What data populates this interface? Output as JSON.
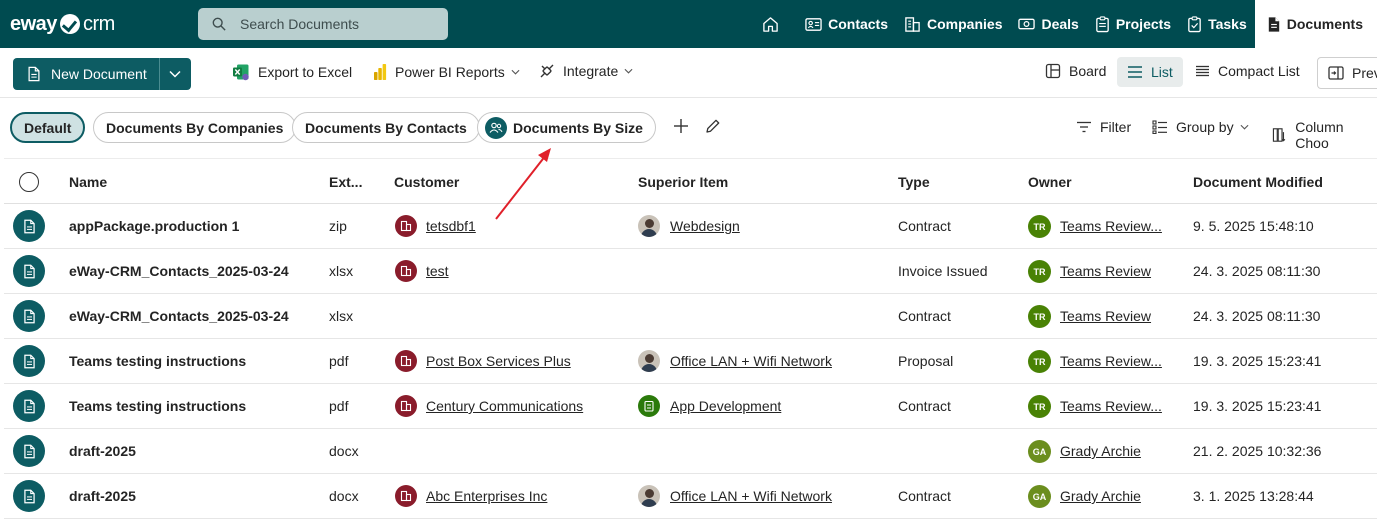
{
  "app": {
    "logo_eway": "eway",
    "logo_crm": "crm"
  },
  "search": {
    "placeholder": "Search Documents",
    "value": ""
  },
  "nav": {
    "items": [
      {
        "label": "Contacts",
        "icon": "contacts-icon"
      },
      {
        "label": "Companies",
        "icon": "companies-icon"
      },
      {
        "label": "Deals",
        "icon": "deals-icon"
      },
      {
        "label": "Projects",
        "icon": "projects-icon"
      },
      {
        "label": "Tasks",
        "icon": "tasks-icon"
      },
      {
        "label": "Documents",
        "icon": "documents-icon",
        "active": true
      }
    ]
  },
  "toolbar": {
    "new_document": "New Document",
    "export_excel": "Export to Excel",
    "power_bi": "Power BI Reports",
    "integrate": "Integrate",
    "board": "Board",
    "list": "List",
    "compact_list": "Compact List",
    "preview": "Prev"
  },
  "views": {
    "tabs": [
      {
        "label": "Default",
        "active": true
      },
      {
        "label": "Documents By Companies"
      },
      {
        "label": "Documents By Contacts"
      },
      {
        "label": "Documents By Size"
      }
    ],
    "filter": "Filter",
    "group_by": "Group by",
    "column_chooser": "Column Choo"
  },
  "table": {
    "columns": [
      "Name",
      "Ext...",
      "Customer",
      "Superior Item",
      "Type",
      "Owner",
      "Document Modified"
    ],
    "rows": [
      {
        "name": "appPackage.production 1",
        "ext": "zip",
        "customer": "tetsdbf1",
        "superior": "Webdesign",
        "superior_icon": "photo",
        "type": "Contract",
        "owner_initials": "TR",
        "owner": "Teams Review...",
        "owner_color": "#498205",
        "modified": "9. 5. 2025 15:48:10"
      },
      {
        "name": "eWay-CRM_Contacts_2025-03-24",
        "ext": "xlsx",
        "customer": "test",
        "superior": "",
        "superior_icon": "",
        "type": "Invoice Issued",
        "owner_initials": "TR",
        "owner": "Teams Review",
        "owner_color": "#498205",
        "modified": "24. 3. 2025 08:11:30"
      },
      {
        "name": "eWay-CRM_Contacts_2025-03-24",
        "ext": "xlsx",
        "customer": "",
        "superior": "",
        "superior_icon": "",
        "type": "Contract",
        "owner_initials": "TR",
        "owner": "Teams Review",
        "owner_color": "#498205",
        "modified": "24. 3. 2025 08:11:30"
      },
      {
        "name": "Teams testing instructions",
        "ext": "pdf",
        "customer": "Post Box Services Plus",
        "superior": "Office LAN + Wifi Network",
        "superior_icon": "photo",
        "type": "Proposal",
        "owner_initials": "TR",
        "owner": "Teams Review...",
        "owner_color": "#498205",
        "modified": "19. 3. 2025 15:23:41"
      },
      {
        "name": "Teams testing instructions",
        "ext": "pdf",
        "customer": "Century Communications",
        "superior": "App Development",
        "superior_icon": "green",
        "type": "Contract",
        "owner_initials": "TR",
        "owner": "Teams Review...",
        "owner_color": "#498205",
        "modified": "19. 3. 2025 15:23:41"
      },
      {
        "name": "draft-2025",
        "ext": "docx",
        "customer": "",
        "superior": "",
        "superior_icon": "",
        "type": "",
        "owner_initials": "GA",
        "owner": "Grady Archie",
        "owner_color": "#6b8e1e",
        "modified": "21. 2. 2025 10:32:36"
      },
      {
        "name": "draft-2025",
        "ext": "docx",
        "customer": "Abc Enterprises Inc",
        "superior": "Office LAN + Wifi Network",
        "superior_icon": "photo",
        "type": "Contract",
        "owner_initials": "GA",
        "owner": "Grady Archie",
        "owner_color": "#6b8e1e",
        "modified": "3. 1. 2025 13:28:44"
      }
    ]
  },
  "colors": {
    "topbar": "#004b50",
    "accent": "#0d5c63",
    "customer_icon": "#8a1c2b",
    "annotation_arrow": "#e0202a"
  }
}
